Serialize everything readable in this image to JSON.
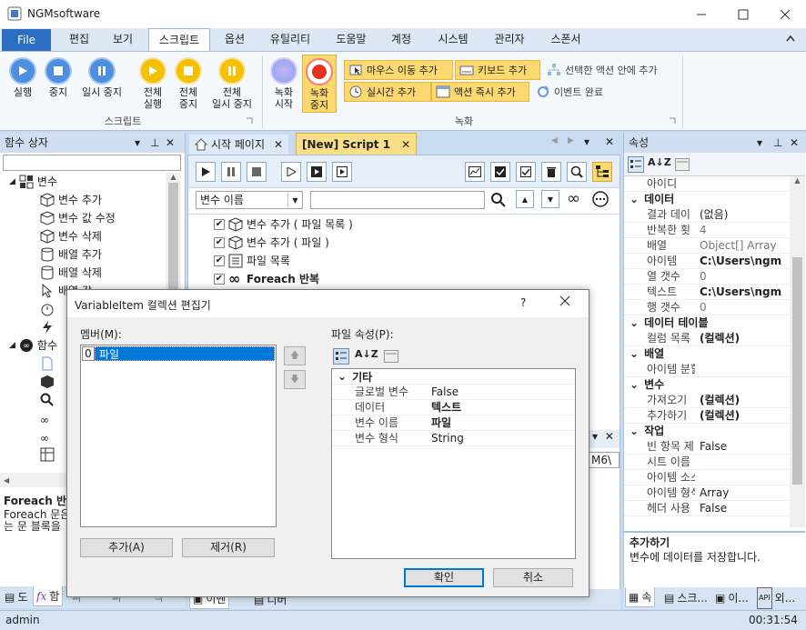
{
  "window": {
    "title": "NGMsoftware"
  },
  "menu": {
    "file": "File",
    "items": [
      "편집",
      "보기",
      "스크립트",
      "옵션",
      "유틸리티",
      "도움말",
      "계정",
      "시스템",
      "관리자",
      "스폰서"
    ]
  },
  "ribbon": {
    "script_group": "스크립트",
    "record_group": "녹화",
    "run": "실행",
    "stop": "중지",
    "pause": "일시 중지",
    "all_run_1": "전체",
    "all_run_2": "실행",
    "all_stop_1": "전체",
    "all_stop_2": "중지",
    "all_pause_1": "전체",
    "all_pause_2": "일시 중지",
    "rec_start_1": "녹화",
    "rec_start_2": "시작",
    "rec_stop_1": "녹화",
    "rec_stop_2": "중지",
    "mouse_move": "마우스 이동 추가",
    "keyboard": "키보드 추가",
    "inside_action": "선택한 액션 안에 추가",
    "realtime": "실시간 추가",
    "action_now": "액션 즉시 추가",
    "event_done": "이벤트 완료"
  },
  "left_pane": {
    "title": "함수 상자",
    "tree": {
      "variables": "변수",
      "add_var": "변수 추가",
      "edit_var": "변수 값 수정",
      "delete_var": "변수 삭제",
      "add_array": "배열 추가",
      "delete_array": "배열 삭제",
      "array_value": "배열 값",
      "func_group": "함수"
    },
    "help_title": "Foreach 반",
    "help_text_1": "Foreach 문은",
    "help_text_2": "는 문 블록을"
  },
  "editor": {
    "tab_start": "시작 페이지",
    "tab_script": "[New] Script 1",
    "var_combo": "변수 이름",
    "path_fragment": "M6\\",
    "rows": [
      "변수 추가 ( 파일 목록 )",
      "변수 추가 ( 파일 )",
      "파일 목록",
      "Foreach 반복"
    ]
  },
  "props": {
    "title": "속성",
    "rows_top": [
      {
        "k": "아이디",
        "v": ""
      }
    ],
    "cat_data": "데이터",
    "rows_data": [
      {
        "k": "결과 데이",
        "v": "(없음)"
      },
      {
        "k": "반복한 횟",
        "v": "4"
      },
      {
        "k": "배열",
        "v": "Object[] Array"
      },
      {
        "k": "아이템",
        "v": "C:\\Users\\ngm"
      },
      {
        "k": "열 갯수",
        "v": "0"
      },
      {
        "k": "텍스트",
        "v": "C:\\Users\\ngm"
      },
      {
        "k": "행 갯수",
        "v": "0"
      }
    ],
    "cat_table": "데이터 테이블",
    "rows_table": [
      {
        "k": "컬럼 목록",
        "v": "(컬렉션)"
      }
    ],
    "cat_array": "배열",
    "rows_array": [
      {
        "k": "아이템 분할",
        "v": ""
      }
    ],
    "cat_var": "변수",
    "rows_var": [
      {
        "k": "가져오기",
        "v": "(컬렉션)"
      },
      {
        "k": "추가하기",
        "v": "(컬렉션)"
      }
    ],
    "cat_work": "작업",
    "rows_work": [
      {
        "k": "빈 항목 제",
        "v": "False"
      },
      {
        "k": "시트 이름",
        "v": ""
      },
      {
        "k": "아이템 소스",
        "v": ""
      },
      {
        "k": "아이템 형식",
        "v": "Array"
      },
      {
        "k": "헤더 사용",
        "v": "False"
      }
    ],
    "desc_title": "추가하기",
    "desc_text": "변수에 데이터를 저장합니다."
  },
  "bottom_tabs": {
    "left": [
      "도",
      "함",
      "파",
      "파",
      "작"
    ],
    "editor": [
      "이벤",
      "디버"
    ],
    "right": [
      "속",
      "스크...",
      "이...",
      "외..."
    ]
  },
  "dialog": {
    "title": "VariableItem 컬렉션 편집기",
    "help": "?",
    "members_label": "멤버(M):",
    "member_index": "0",
    "member_name": "파일",
    "props_label": "파일 속성(P):",
    "category": "기타",
    "rows": [
      {
        "k": "글로벌 변수",
        "v": "False",
        "bold": false
      },
      {
        "k": "데이터",
        "v": "텍스트",
        "bold": true
      },
      {
        "k": "변수 이름",
        "v": "파일",
        "bold": true
      },
      {
        "k": "변수 형식",
        "v": "String",
        "bold": false
      }
    ],
    "add": "추가(A)",
    "remove": "제거(R)",
    "ok": "확인",
    "cancel": "취소"
  },
  "status": {
    "user": "admin",
    "time": "00:31:54"
  }
}
